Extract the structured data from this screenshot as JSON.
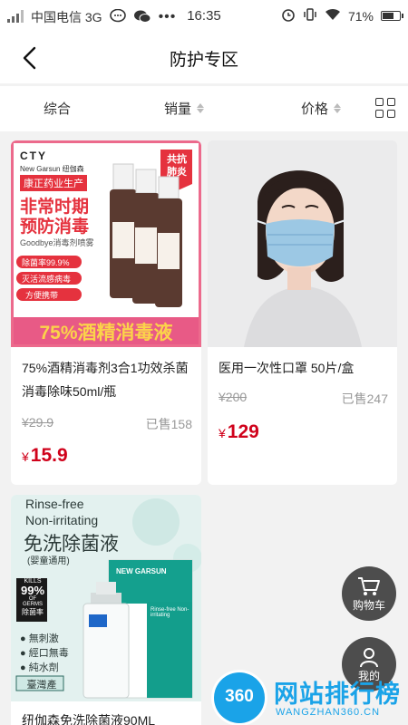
{
  "status_bar": {
    "carrier": "中国电信 3G",
    "time": "16:35",
    "battery": "71%",
    "battery_level": 0.71
  },
  "header": {
    "title": "防护专区"
  },
  "filters": {
    "comprehensive": "综合",
    "sales": "销量",
    "price": "价格"
  },
  "products": [
    {
      "name": "75%酒精消毒剂3合1功效杀菌消毒除味50ml/瓶",
      "original_price": "¥29.9",
      "sold": "已售158",
      "price_symbol": "¥",
      "price": "15.9",
      "image_text": {
        "brand": "CTY",
        "brand_sub": "New Garsun 纽伽森",
        "maker": "康正药业生产",
        "badge": "共抗肺炎",
        "headline1": "非常时期",
        "headline2": "预防消毒",
        "subline": "Goodbye消毒剂喷雾",
        "feature1": "除菌率99.9%",
        "feature2": "灭活流感病毒",
        "feature3": "方便携带",
        "banner": "75%酒精消毒液"
      }
    },
    {
      "name": "医用一次性口罩 50片/盒",
      "original_price": "¥200",
      "sold": "已售247",
      "price_symbol": "¥",
      "price": "129"
    },
    {
      "name": "纽伽森免洗除菌液90ML",
      "image_text": {
        "en1": "Rinse-free",
        "en2": "Non-irritating",
        "cn": "免洗除菌液",
        "cn_sub": "(婴童通用)",
        "kills": "KILLS",
        "pct": "99%",
        "germs": "OF GERMS",
        "germs_cn": "除菌率",
        "f1": "● 無刺激",
        "f2": "● 經口無毒",
        "f3": "● 純水劑",
        "origin": "臺灣產",
        "box_brand": "NEW GARSUN",
        "box_en": "Rinse-free Non-irritating"
      }
    }
  ],
  "float_buttons": {
    "cart": "购物车",
    "mine": "我的"
  },
  "watermark": {
    "badge": "360",
    "title": "网站排行榜",
    "url": "WANGZHAN360.CN"
  },
  "colors": {
    "price_red": "#d0021b",
    "banner_orange": "#f5a623",
    "badge_red": "#e5323e"
  }
}
